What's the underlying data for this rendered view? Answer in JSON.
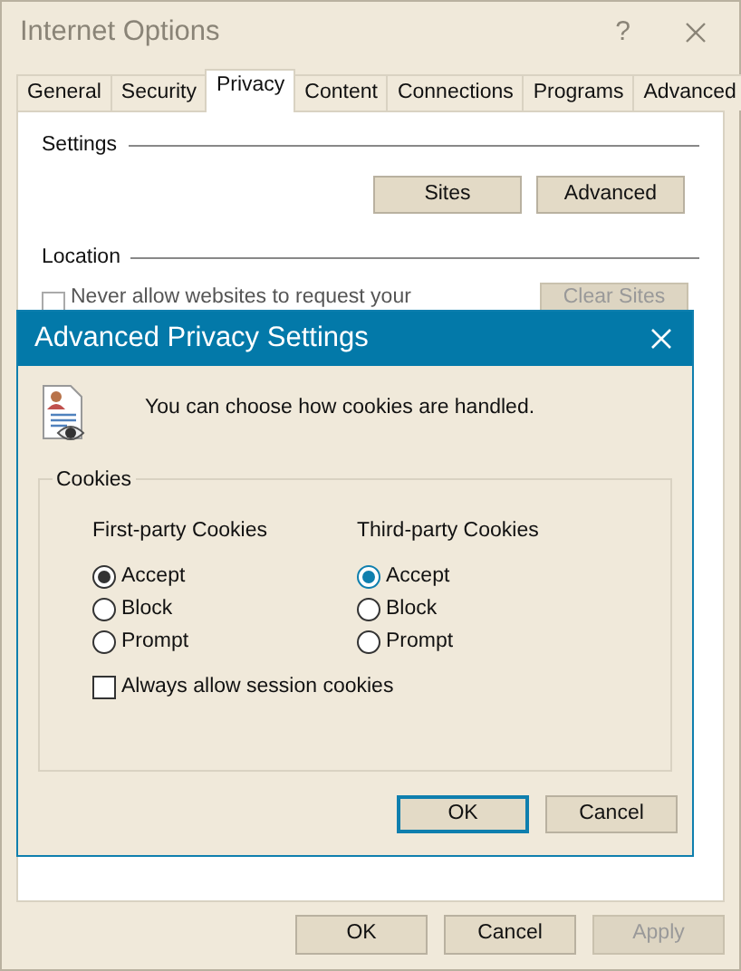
{
  "window": {
    "title": "Internet Options",
    "help_button": "?"
  },
  "tabs": [
    {
      "label": "General",
      "selected": false
    },
    {
      "label": "Security",
      "selected": false
    },
    {
      "label": "Privacy",
      "selected": true
    },
    {
      "label": "Content",
      "selected": false
    },
    {
      "label": "Connections",
      "selected": false
    },
    {
      "label": "Programs",
      "selected": false
    },
    {
      "label": "Advanced",
      "selected": false
    }
  ],
  "privacy_panel": {
    "settings_heading": "Settings",
    "settings_buttons": [
      "Sites",
      "Advanced"
    ],
    "location_heading": "Location",
    "location_checkbox": {
      "label": "Never allow websites to request your",
      "checked": false
    },
    "clear_sites_button": {
      "label": "Clear Sites",
      "disabled": true
    }
  },
  "dialog": {
    "title": "Advanced Privacy Settings",
    "message": "You can choose how cookies are handled.",
    "group_title": "Cookies",
    "columns": [
      {
        "heading": "First-party Cookies",
        "options": [
          {
            "label": "Accept",
            "selected": true,
            "focused": false
          },
          {
            "label": "Block",
            "selected": false,
            "focused": false
          },
          {
            "label": "Prompt",
            "selected": false,
            "focused": false
          }
        ]
      },
      {
        "heading": "Third-party Cookies",
        "options": [
          {
            "label": "Accept",
            "selected": true,
            "focused": true
          },
          {
            "label": "Block",
            "selected": false,
            "focused": false
          },
          {
            "label": "Prompt",
            "selected": false,
            "focused": false
          }
        ]
      }
    ],
    "session_checkbox": {
      "label": "Always allow session cookies",
      "checked": false
    },
    "buttons": [
      {
        "label": "OK",
        "default": true
      },
      {
        "label": "Cancel",
        "default": false
      }
    ]
  },
  "footer_buttons": [
    {
      "label": "OK",
      "disabled": false
    },
    {
      "label": "Cancel",
      "disabled": false
    },
    {
      "label": "Apply",
      "disabled": true
    }
  ]
}
